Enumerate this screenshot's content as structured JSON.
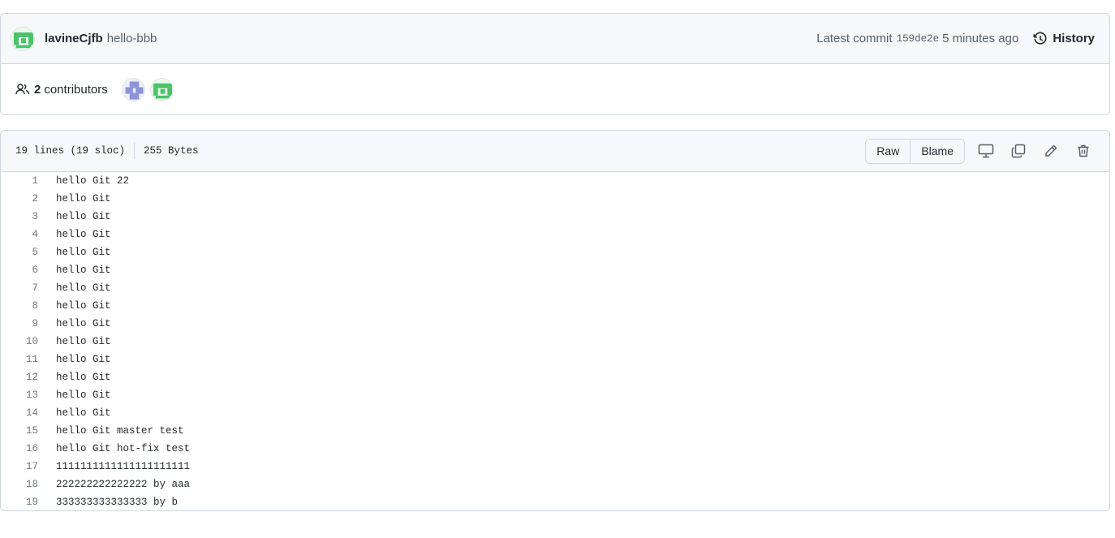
{
  "commit": {
    "author": "lavineCjfb",
    "message": "hello-bbb",
    "latest_label": "Latest commit",
    "sha": "159de2e",
    "time_ago": "5 minutes ago",
    "history_label": "History"
  },
  "contributors": {
    "count": "2",
    "label": "contributors"
  },
  "file": {
    "lines_info": "19 lines (19 sloc)",
    "size": "255 Bytes",
    "raw_label": "Raw",
    "blame_label": "Blame"
  },
  "code_lines": [
    {
      "n": "1",
      "text": "hello Git 22"
    },
    {
      "n": "2",
      "text": "hello Git"
    },
    {
      "n": "3",
      "text": "hello Git"
    },
    {
      "n": "4",
      "text": "hello Git"
    },
    {
      "n": "5",
      "text": "hello Git"
    },
    {
      "n": "6",
      "text": "hello Git"
    },
    {
      "n": "7",
      "text": "hello Git"
    },
    {
      "n": "8",
      "text": "hello Git"
    },
    {
      "n": "9",
      "text": "hello Git"
    },
    {
      "n": "10",
      "text": "hello Git"
    },
    {
      "n": "11",
      "text": "hello Git"
    },
    {
      "n": "12",
      "text": "hello Git"
    },
    {
      "n": "13",
      "text": "hello Git"
    },
    {
      "n": "14",
      "text": "hello Git"
    },
    {
      "n": "15",
      "text": "hello Git master test"
    },
    {
      "n": "16",
      "text": "hello Git hot-fix test"
    },
    {
      "n": "17",
      "text": "1111111111111111111111"
    },
    {
      "n": "18",
      "text": "222222222222222 by aaa"
    },
    {
      "n": "19",
      "text": "333333333333333 by b"
    }
  ],
  "colors": {
    "avatar_green": "#4cc36b",
    "avatar_blue": "#8d93d8",
    "border": "#d0d7de",
    "header_bg": "#f6f8fa"
  }
}
